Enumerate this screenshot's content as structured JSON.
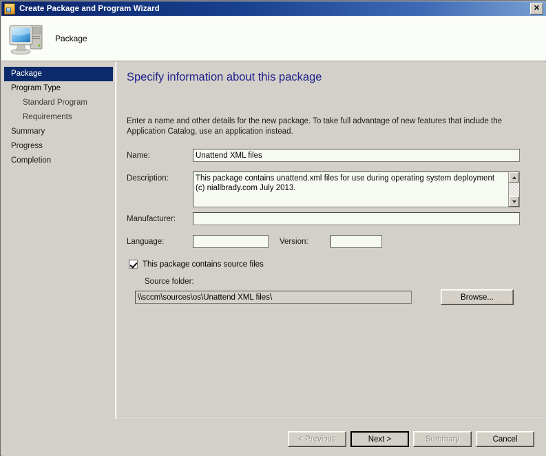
{
  "window": {
    "title": "Create Package and Program Wizard",
    "title_icon": "package-wizard-icon",
    "close_label": "✕"
  },
  "header": {
    "icon": "computer-monitor-icon",
    "title": "Package"
  },
  "sidebar": {
    "items": [
      {
        "label": "Package",
        "level": 0,
        "selected": true
      },
      {
        "label": "Program Type",
        "level": 0,
        "selected": false
      },
      {
        "label": "Standard Program",
        "level": 1,
        "selected": false
      },
      {
        "label": "Requirements",
        "level": 1,
        "selected": false
      },
      {
        "label": "Summary",
        "level": 0,
        "selected": false
      },
      {
        "label": "Progress",
        "level": 0,
        "selected": false
      },
      {
        "label": "Completion",
        "level": 0,
        "selected": false
      }
    ]
  },
  "main": {
    "heading": "Specify information about this package",
    "intro": "Enter a name and other details for the new package. To take full advantage of new features that include the Application Catalog, use an application instead.",
    "fields": {
      "name_label": "Name:",
      "name_value": "Unattend XML files",
      "description_label": "Description:",
      "description_value": "This package contains unattend.xml files for use during operating system deployment (c) niallbrady.com July 2013.",
      "manufacturer_label": "Manufacturer:",
      "manufacturer_value": "",
      "language_label": "Language:",
      "language_value": "",
      "version_label": "Version:",
      "version_value": ""
    },
    "source": {
      "checkbox_label": "This package contains source files",
      "checkbox_checked": true,
      "folder_label": "Source folder:",
      "folder_value": "\\\\sccm\\sources\\os\\Unattend XML files\\",
      "browse_label": "Browse..."
    }
  },
  "footer": {
    "buttons": [
      {
        "label": "< Previous",
        "enabled": false,
        "default": false
      },
      {
        "label": "Next >",
        "enabled": true,
        "default": true
      },
      {
        "label": "Summary",
        "enabled": false,
        "default": false
      },
      {
        "label": "Cancel",
        "enabled": true,
        "default": false
      }
    ]
  },
  "colors": {
    "titlebar_start": "#0a246a",
    "titlebar_end": "#7aa0d2",
    "selection": "#0c2a6b",
    "heading": "#20208c",
    "panel": "#d2d0c8",
    "field_bg": "#f7faf3"
  }
}
